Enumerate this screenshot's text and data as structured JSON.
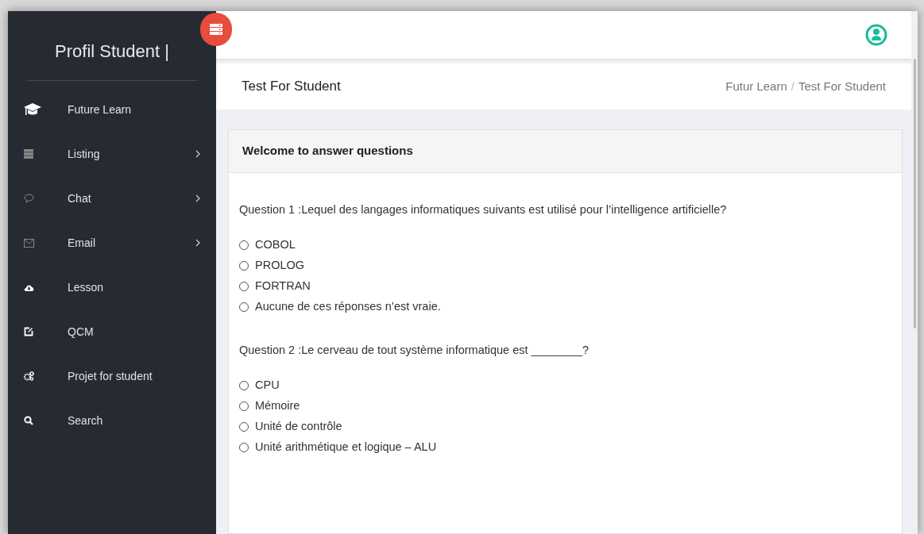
{
  "sidebar": {
    "title": "Profil Student |",
    "items": [
      {
        "label": "Future Learn",
        "submenu": false
      },
      {
        "label": "Listing",
        "submenu": true
      },
      {
        "label": "Chat",
        "submenu": true
      },
      {
        "label": "Email",
        "submenu": true
      },
      {
        "label": "Lesson",
        "submenu": false
      },
      {
        "label": "QCM",
        "submenu": false
      },
      {
        "label": "Projet for student",
        "submenu": false
      },
      {
        "label": "Search",
        "submenu": false
      }
    ]
  },
  "page_header": {
    "title": "Test For Student",
    "breadcrumb": [
      "Futur Learn",
      "Test For Student"
    ],
    "separator": "/"
  },
  "card": {
    "title": "Welcome to answer questions",
    "questions": [
      {
        "text": "Question 1 :Lequel des langages informatiques suivants est utilisé pour l’intelligence artificielle?",
        "options": [
          {
            "label": "COBOL",
            "selected": false
          },
          {
            "label": "PROLOG",
            "selected": false
          },
          {
            "label": "FORTRAN",
            "selected": false
          },
          {
            "label": "Aucune de ces réponses n’est vraie.",
            "selected": false
          }
        ]
      },
      {
        "text": "Question 2 :Le cerveau de tout système informatique est ________?",
        "options": [
          {
            "label": "CPU",
            "selected": false
          },
          {
            "label": "Mémoire",
            "selected": false
          },
          {
            "label": "Unité de contrôle",
            "selected": false
          },
          {
            "label": "Unité arithmétique et logique – ALU",
            "selected": false
          }
        ]
      }
    ]
  }
}
